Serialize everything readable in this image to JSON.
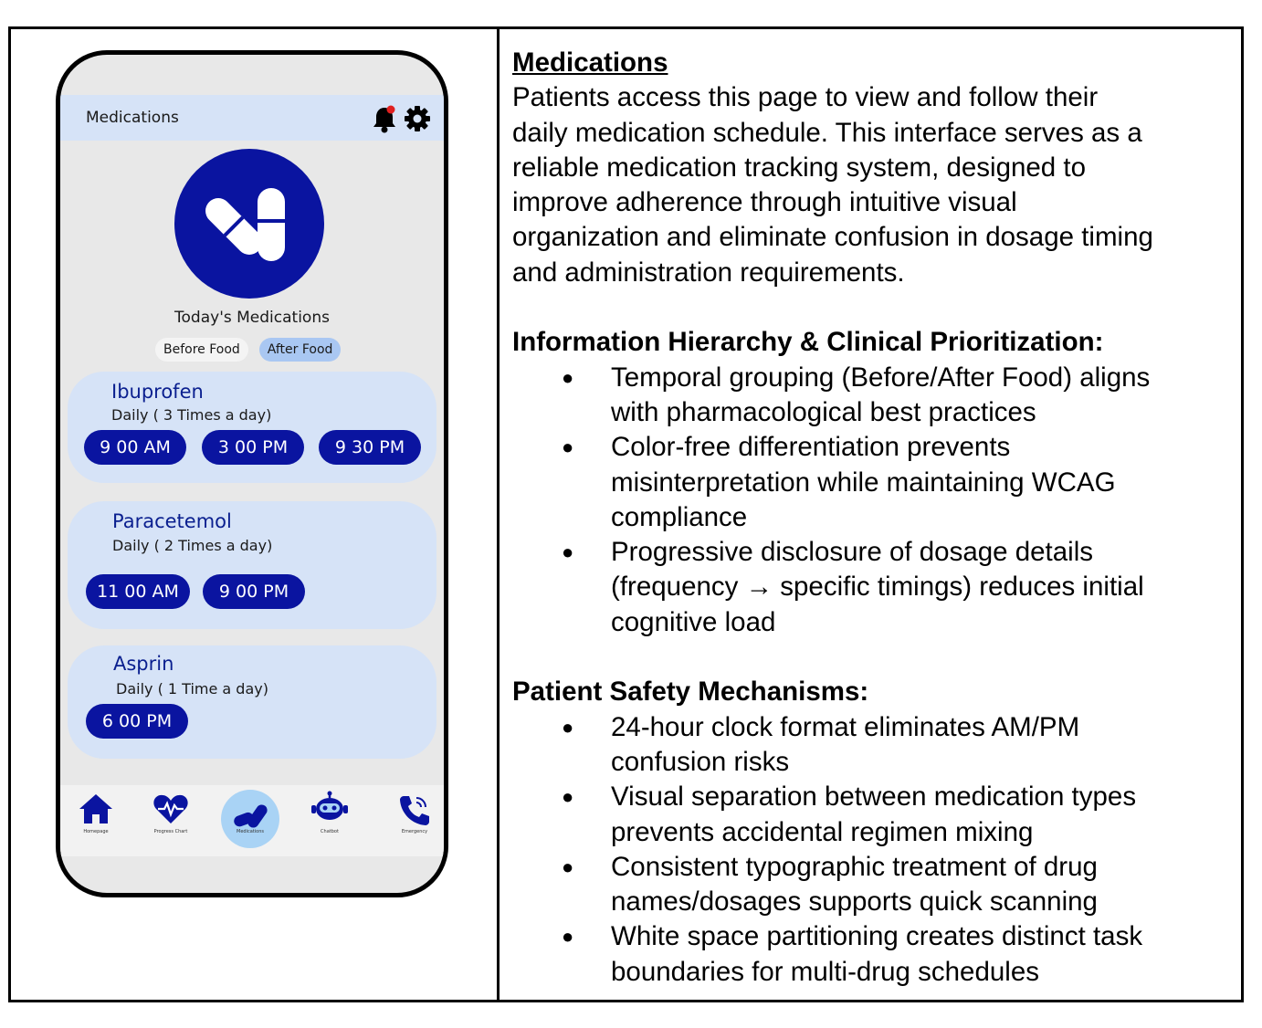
{
  "phone": {
    "header_title": "Medications",
    "icons": {
      "bell": "bell-icon",
      "settings": "gear-icon",
      "hero": "pills-icon"
    },
    "today_title": "Today's Medications",
    "filters": [
      {
        "label": "Before Food",
        "active": false
      },
      {
        "label": "After Food",
        "active": true
      }
    ],
    "medications": [
      {
        "name": "Ibuprofen",
        "frequency": "Daily ( 3 Times a day)",
        "times": [
          "9 00 AM",
          "3 00 PM",
          "9 30 PM"
        ]
      },
      {
        "name": "Paracetemol",
        "frequency": "Daily ( 2 Times a day)",
        "times": [
          "11 00 AM",
          "9 00 PM"
        ]
      },
      {
        "name": "Asprin",
        "frequency": "Daily ( 1 Time a day)",
        "times": [
          "6 00 PM"
        ]
      }
    ],
    "nav": [
      {
        "label": "Homepage",
        "icon": "home-icon"
      },
      {
        "label": "Progress Chart",
        "icon": "heart-pulse-icon"
      },
      {
        "label": "Medications",
        "icon": "pills-icon",
        "active": true
      },
      {
        "label": "Chatbot",
        "icon": "robot-icon"
      },
      {
        "label": "Emergency",
        "icon": "phone-icon"
      }
    ],
    "colors": {
      "accent": "#0a14a0",
      "card": "#d6e3f7",
      "active_nav": "#a9d3f5",
      "notification_dot": "#e02020"
    }
  },
  "description": {
    "title": "Medications",
    "intro_lines": [
      "Patients access this page to view and follow their",
      "daily medication schedule. This interface serves as a",
      "reliable medication tracking system, designed to",
      "improve adherence through intuitive visual",
      "organization and eliminate confusion in dosage timing",
      "and administration requirements."
    ],
    "section1_heading": "Information Hierarchy & Clinical Prioritization:",
    "section1_bullets": [
      [
        "Temporal grouping (Before/After Food) aligns",
        "with pharmacological best practices"
      ],
      [
        "Color-free differentiation prevents",
        "misinterpretation while maintaining WCAG",
        "compliance"
      ],
      [
        "Progressive disclosure of dosage details",
        "(frequency → specific timings) reduces initial",
        "cognitive load"
      ]
    ],
    "section2_heading": "Patient Safety Mechanisms:",
    "section2_bullets": [
      [
        "24-hour clock format eliminates AM/PM",
        "confusion risks"
      ],
      [
        "Visual separation between medication types",
        "prevents accidental regimen mixing"
      ],
      [
        "Consistent typographic treatment of drug",
        "names/dosages supports quick scanning"
      ],
      [
        "White space partitioning creates distinct task",
        "boundaries for multi-drug schedules"
      ]
    ]
  }
}
